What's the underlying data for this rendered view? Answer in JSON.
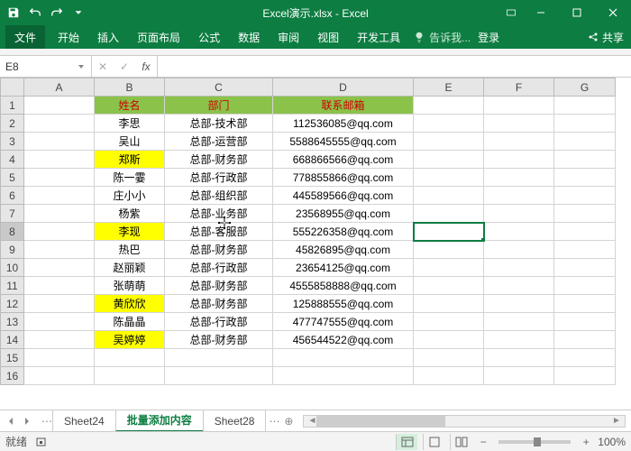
{
  "app": {
    "title": "Excel演示.xlsx - Excel"
  },
  "ribbon": {
    "file": "文件",
    "tabs": [
      "开始",
      "插入",
      "页面布局",
      "公式",
      "数据",
      "审阅",
      "视图",
      "开发工具"
    ],
    "tell_me": "告诉我...",
    "login": "登录",
    "share": "共享"
  },
  "formula": {
    "name_box": "E8",
    "value": ""
  },
  "columns": [
    "A",
    "B",
    "C",
    "D",
    "E",
    "F",
    "G"
  ],
  "headers": {
    "name": "姓名",
    "dept": "部门",
    "email": "联系邮箱"
  },
  "rows": [
    {
      "n": 1,
      "name": "",
      "dept": "",
      "email": "",
      "is_header": true
    },
    {
      "n": 2,
      "name": "李思",
      "dept": "总部-技术部",
      "email": "112536085@qq.com",
      "hl": false
    },
    {
      "n": 3,
      "name": "吴山",
      "dept": "总部-运营部",
      "email": "5588645555@qq.com",
      "hl": false
    },
    {
      "n": 4,
      "name": "郑斯",
      "dept": "总部-财务部",
      "email": "668866566@qq.com",
      "hl": true
    },
    {
      "n": 5,
      "name": "陈一霎",
      "dept": "总部-行政部",
      "email": "778855866@qq.com",
      "hl": false
    },
    {
      "n": 6,
      "name": "庄小小",
      "dept": "总部-组织部",
      "email": "445589566@qq.com",
      "hl": false
    },
    {
      "n": 7,
      "name": "杨紫",
      "dept": "总部-业务部",
      "email": "23568955@qq.com",
      "hl": false
    },
    {
      "n": 8,
      "name": "李现",
      "dept": "总部-客服部",
      "email": "555226358@qq.com",
      "hl": true
    },
    {
      "n": 9,
      "name": "热巴",
      "dept": "总部-财务部",
      "email": "45826895@qq.com",
      "hl": false
    },
    {
      "n": 10,
      "name": "赵丽颖",
      "dept": "总部-行政部",
      "email": "23654125@qq.com",
      "hl": false
    },
    {
      "n": 11,
      "name": "张萌萌",
      "dept": "总部-财务部",
      "email": "4555858888@qq.com",
      "hl": false
    },
    {
      "n": 12,
      "name": "黄欣欣",
      "dept": "总部-财务部",
      "email": "125888555@qq.com",
      "hl": true
    },
    {
      "n": 13,
      "name": "陈晶晶",
      "dept": "总部-行政部",
      "email": "477747555@qq.com",
      "hl": false
    },
    {
      "n": 14,
      "name": "吴婷婷",
      "dept": "总部-财务部",
      "email": "456544522@qq.com",
      "hl": true
    },
    {
      "n": 15,
      "name": "",
      "dept": "",
      "email": "",
      "hl": false
    },
    {
      "n": 16,
      "name": "",
      "dept": "",
      "email": "",
      "hl": false
    }
  ],
  "sheet_tabs": {
    "list": [
      "Sheet24",
      "批量添加内容",
      "Sheet28"
    ],
    "active": 1
  },
  "status": {
    "ready": "就绪",
    "zoom": "100%"
  }
}
